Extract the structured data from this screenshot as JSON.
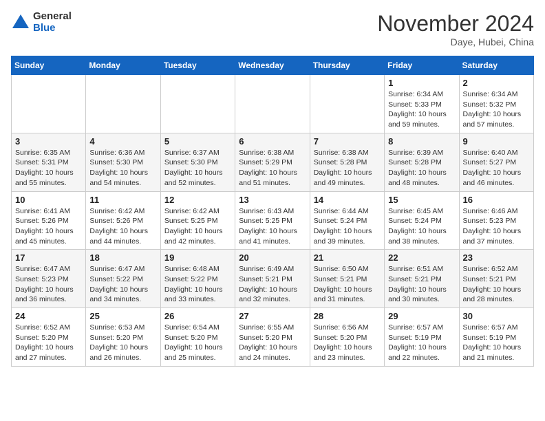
{
  "logo": {
    "general": "General",
    "blue": "Blue"
  },
  "header": {
    "month": "November 2024",
    "location": "Daye, Hubei, China"
  },
  "weekdays": [
    "Sunday",
    "Monday",
    "Tuesday",
    "Wednesday",
    "Thursday",
    "Friday",
    "Saturday"
  ],
  "weeks": [
    [
      {
        "day": "",
        "info": ""
      },
      {
        "day": "",
        "info": ""
      },
      {
        "day": "",
        "info": ""
      },
      {
        "day": "",
        "info": ""
      },
      {
        "day": "",
        "info": ""
      },
      {
        "day": "1",
        "info": "Sunrise: 6:34 AM\nSunset: 5:33 PM\nDaylight: 10 hours and 59 minutes."
      },
      {
        "day": "2",
        "info": "Sunrise: 6:34 AM\nSunset: 5:32 PM\nDaylight: 10 hours and 57 minutes."
      }
    ],
    [
      {
        "day": "3",
        "info": "Sunrise: 6:35 AM\nSunset: 5:31 PM\nDaylight: 10 hours and 55 minutes."
      },
      {
        "day": "4",
        "info": "Sunrise: 6:36 AM\nSunset: 5:30 PM\nDaylight: 10 hours and 54 minutes."
      },
      {
        "day": "5",
        "info": "Sunrise: 6:37 AM\nSunset: 5:30 PM\nDaylight: 10 hours and 52 minutes."
      },
      {
        "day": "6",
        "info": "Sunrise: 6:38 AM\nSunset: 5:29 PM\nDaylight: 10 hours and 51 minutes."
      },
      {
        "day": "7",
        "info": "Sunrise: 6:38 AM\nSunset: 5:28 PM\nDaylight: 10 hours and 49 minutes."
      },
      {
        "day": "8",
        "info": "Sunrise: 6:39 AM\nSunset: 5:28 PM\nDaylight: 10 hours and 48 minutes."
      },
      {
        "day": "9",
        "info": "Sunrise: 6:40 AM\nSunset: 5:27 PM\nDaylight: 10 hours and 46 minutes."
      }
    ],
    [
      {
        "day": "10",
        "info": "Sunrise: 6:41 AM\nSunset: 5:26 PM\nDaylight: 10 hours and 45 minutes."
      },
      {
        "day": "11",
        "info": "Sunrise: 6:42 AM\nSunset: 5:26 PM\nDaylight: 10 hours and 44 minutes."
      },
      {
        "day": "12",
        "info": "Sunrise: 6:42 AM\nSunset: 5:25 PM\nDaylight: 10 hours and 42 minutes."
      },
      {
        "day": "13",
        "info": "Sunrise: 6:43 AM\nSunset: 5:25 PM\nDaylight: 10 hours and 41 minutes."
      },
      {
        "day": "14",
        "info": "Sunrise: 6:44 AM\nSunset: 5:24 PM\nDaylight: 10 hours and 39 minutes."
      },
      {
        "day": "15",
        "info": "Sunrise: 6:45 AM\nSunset: 5:24 PM\nDaylight: 10 hours and 38 minutes."
      },
      {
        "day": "16",
        "info": "Sunrise: 6:46 AM\nSunset: 5:23 PM\nDaylight: 10 hours and 37 minutes."
      }
    ],
    [
      {
        "day": "17",
        "info": "Sunrise: 6:47 AM\nSunset: 5:23 PM\nDaylight: 10 hours and 36 minutes."
      },
      {
        "day": "18",
        "info": "Sunrise: 6:47 AM\nSunset: 5:22 PM\nDaylight: 10 hours and 34 minutes."
      },
      {
        "day": "19",
        "info": "Sunrise: 6:48 AM\nSunset: 5:22 PM\nDaylight: 10 hours and 33 minutes."
      },
      {
        "day": "20",
        "info": "Sunrise: 6:49 AM\nSunset: 5:21 PM\nDaylight: 10 hours and 32 minutes."
      },
      {
        "day": "21",
        "info": "Sunrise: 6:50 AM\nSunset: 5:21 PM\nDaylight: 10 hours and 31 minutes."
      },
      {
        "day": "22",
        "info": "Sunrise: 6:51 AM\nSunset: 5:21 PM\nDaylight: 10 hours and 30 minutes."
      },
      {
        "day": "23",
        "info": "Sunrise: 6:52 AM\nSunset: 5:21 PM\nDaylight: 10 hours and 28 minutes."
      }
    ],
    [
      {
        "day": "24",
        "info": "Sunrise: 6:52 AM\nSunset: 5:20 PM\nDaylight: 10 hours and 27 minutes."
      },
      {
        "day": "25",
        "info": "Sunrise: 6:53 AM\nSunset: 5:20 PM\nDaylight: 10 hours and 26 minutes."
      },
      {
        "day": "26",
        "info": "Sunrise: 6:54 AM\nSunset: 5:20 PM\nDaylight: 10 hours and 25 minutes."
      },
      {
        "day": "27",
        "info": "Sunrise: 6:55 AM\nSunset: 5:20 PM\nDaylight: 10 hours and 24 minutes."
      },
      {
        "day": "28",
        "info": "Sunrise: 6:56 AM\nSunset: 5:20 PM\nDaylight: 10 hours and 23 minutes."
      },
      {
        "day": "29",
        "info": "Sunrise: 6:57 AM\nSunset: 5:19 PM\nDaylight: 10 hours and 22 minutes."
      },
      {
        "day": "30",
        "info": "Sunrise: 6:57 AM\nSunset: 5:19 PM\nDaylight: 10 hours and 21 minutes."
      }
    ]
  ]
}
